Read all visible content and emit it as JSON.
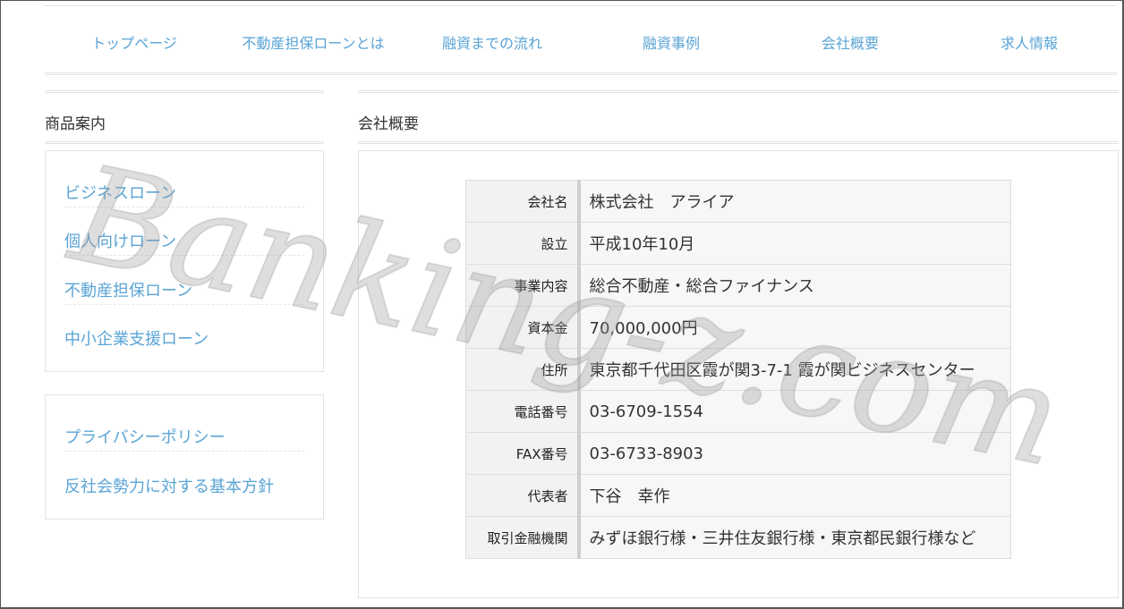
{
  "nav": {
    "items": [
      {
        "label": "トップページ"
      },
      {
        "label": "不動産担保ローンとは"
      },
      {
        "label": "融資までの流れ"
      },
      {
        "label": "融資事例"
      },
      {
        "label": "会社概要"
      },
      {
        "label": "求人情報"
      }
    ]
  },
  "sidebar": {
    "title": "商品案内",
    "products": [
      {
        "label": "ビジネスローン"
      },
      {
        "label": "個人向けローン"
      },
      {
        "label": "不動産担保ローン"
      },
      {
        "label": "中小企業支援ローン"
      }
    ],
    "policies": [
      {
        "label": "プライバシーポリシー"
      },
      {
        "label": "反社会勢力に対する基本方針"
      }
    ]
  },
  "main": {
    "title": "会社概要",
    "rows": [
      {
        "label": "会社名",
        "value": "株式会社　アライア"
      },
      {
        "label": "設立",
        "value": "平成10年10月"
      },
      {
        "label": "事業内容",
        "value": "総合不動産・総合ファイナンス"
      },
      {
        "label": "資本金",
        "value": "70,000,000円"
      },
      {
        "label": "住所",
        "value": "東京都千代田区霞が関3-7-1 霞が関ビジネスセンター"
      },
      {
        "label": "電話番号",
        "value": "03-6709-1554"
      },
      {
        "label": "FAX番号",
        "value": "03-6733-8903"
      },
      {
        "label": "代表者",
        "value": "下谷　幸作"
      },
      {
        "label": "取引金融機関",
        "value": "みずほ銀行様・三井住友銀行様・東京都民銀行様など"
      }
    ]
  },
  "watermark": {
    "text": "Banking-z.com"
  },
  "colors": {
    "link": "#5aa4d6",
    "border": "#e3e3e3",
    "label_bg": "#f2f2f2",
    "value_bg": "#f7f7f7"
  }
}
